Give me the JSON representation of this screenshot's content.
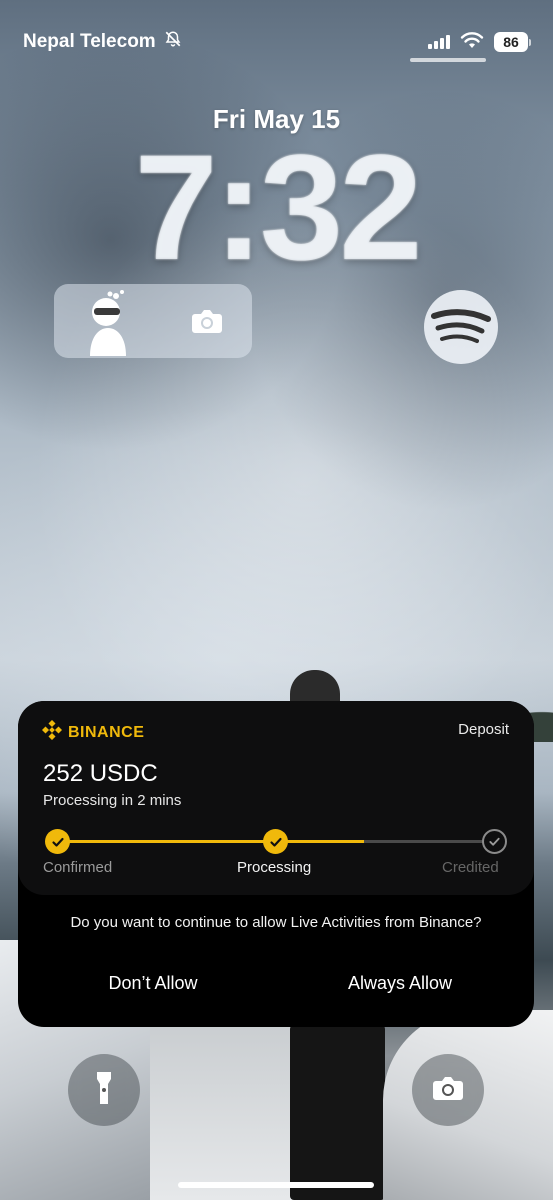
{
  "status_bar": {
    "carrier": "Nepal Telecom",
    "battery": "86"
  },
  "lock_screen": {
    "date": "Fri May 15",
    "time": "7:32"
  },
  "widgets": {
    "left_icons": [
      "avatar-icon",
      "camera-icon"
    ],
    "right_icon": "spotify-icon"
  },
  "live_activity": {
    "brand": "BINANCE",
    "type": "Deposit",
    "amount": "252 USDC",
    "eta": "Processing in 2 mins",
    "progress": 0.7,
    "steps": [
      {
        "label": "Confirmed",
        "state": "done"
      },
      {
        "label": "Processing",
        "state": "done"
      },
      {
        "label": "Credited",
        "state": "pending"
      }
    ],
    "prompt": "Do you want to continue to allow Live Activities from Binance?",
    "deny_label": "Don’t Allow",
    "allow_label": "Always Allow"
  },
  "colors": {
    "accent": "#f0b90b",
    "card_bg": "#000000"
  },
  "bottom_controls": {
    "left": "flashlight-icon",
    "right": "camera-icon"
  }
}
